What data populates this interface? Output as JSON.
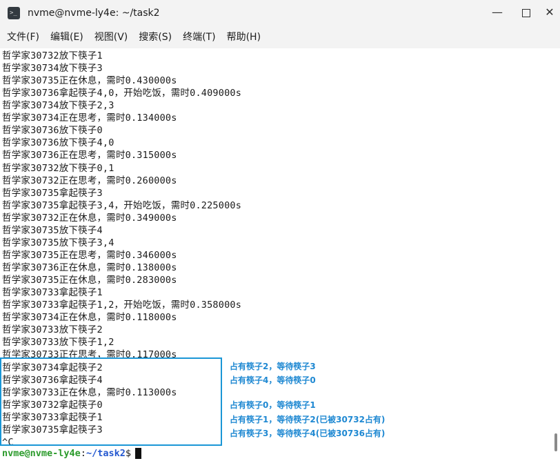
{
  "window": {
    "title": "nvme@nvme-ly4e: ~/task2",
    "minimize_glyph": "—",
    "close_glyph": "✕"
  },
  "menu": [
    "文件(F)",
    "编辑(E)",
    "视图(V)",
    "搜索(S)",
    "终端(T)",
    "帮助(H)"
  ],
  "terminal_lines": [
    "哲学家30732放下筷子1",
    "哲学家30734放下筷子3",
    "哲学家30735正在休息，需时0.430000s",
    "哲学家30736拿起筷子4,0，开始吃饭，需时0.409000s",
    "哲学家30734放下筷子2,3",
    "哲学家30734正在思考，需时0.134000s",
    "哲学家30736放下筷子0",
    "哲学家30736放下筷子4,0",
    "哲学家30736正在思考，需时0.315000s",
    "哲学家30732放下筷子0,1",
    "哲学家30732正在思考，需时0.260000s",
    "哲学家30735拿起筷子3",
    "哲学家30735拿起筷子3,4，开始吃饭，需时0.225000s",
    "哲学家30732正在休息，需时0.349000s",
    "哲学家30735放下筷子4",
    "哲学家30735放下筷子3,4",
    "哲学家30735正在思考，需时0.346000s",
    "哲学家30736正在休息，需时0.138000s",
    "哲学家30735正在休息，需时0.283000s",
    "哲学家30733拿起筷子1",
    "哲学家30733拿起筷子1,2，开始吃饭，需时0.358000s",
    "哲学家30734正在休息，需时0.118000s",
    "哲学家30733放下筷子2",
    "哲学家30733放下筷子1,2",
    "哲学家30733正在思考，需时0.117000s",
    "哲学家30734拿起筷子2",
    "哲学家30736拿起筷子4",
    "哲学家30733正在休息，需时0.113000s",
    "哲学家30732拿起筷子0",
    "哲学家30733拿起筷子1",
    "哲学家30735拿起筷子3",
    "^C"
  ],
  "annotations": [
    "占有筷子2，等待筷子3",
    "占有筷子4，等待筷子0",
    "占有筷子0，等待筷子1",
    "占有筷子1，等待筷子2(已被30732占有)",
    "占有筷子3，等待筷子4(已被30736占有)"
  ],
  "prompt": {
    "user_host": "nvme@nvme-ly4e",
    "colon": ":",
    "path": "~/task2",
    "symbol": "$"
  },
  "colors": {
    "highlight_border": "#1a96d6",
    "annotation_text": "#1e88d2",
    "prompt_user": "#2a9a2a",
    "prompt_path": "#2458d0"
  },
  "icons": {
    "app": "terminal-icon",
    "minimize": "minimize-icon",
    "maximize": "maximize-icon",
    "close": "close-icon"
  }
}
